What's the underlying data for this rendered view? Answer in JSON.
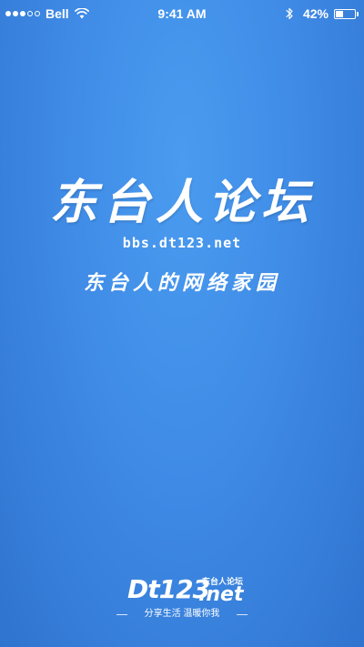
{
  "status_bar": {
    "signal_filled": 3,
    "signal_total": 5,
    "carrier": "Bell",
    "time": "9:41 AM",
    "battery_percent_text": "42%",
    "battery_level": 0.42,
    "icons": [
      "signal-dots-icon",
      "wifi-icon",
      "bluetooth-icon",
      "battery-icon"
    ]
  },
  "splash": {
    "title": "东台人论坛",
    "url": "bbs.dt123.net",
    "slogan": "东台人的网络家园"
  },
  "footer": {
    "logo_main": "Dt123",
    "logo_badge": "东台人论坛",
    "logo_net": ".net",
    "tagline": "分享生活 温暖你我"
  },
  "colors": {
    "background_light": "#4a9cf0",
    "background_mid": "#3f8be6",
    "background_dark": "#2f74cf",
    "foreground": "#ffffff"
  }
}
